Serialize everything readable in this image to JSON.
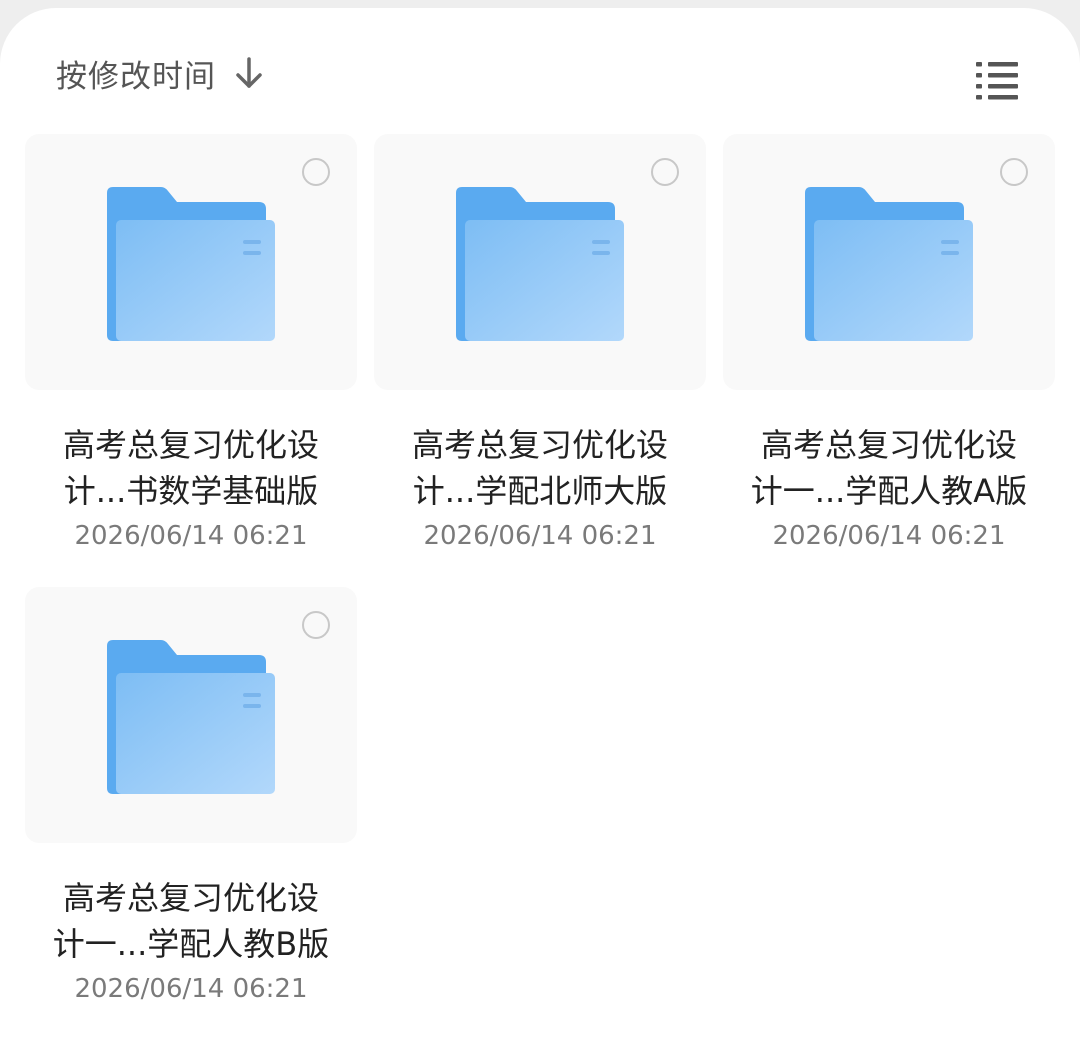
{
  "toolbar": {
    "sort_label": "按修改时间",
    "sort_icon": "arrow-down-icon",
    "view_icon": "list-view-icon"
  },
  "colors": {
    "folder_back": "#5aaaf0",
    "folder_front_start": "#7dbdf4",
    "folder_front_end": "#b2d8fb",
    "card_bg": "#f9f9f9"
  },
  "folders": [
    {
      "name": "高考总复习优化设\n计...书数学基础版",
      "date": "2026/06/14 06:21",
      "icon": "folder-icon"
    },
    {
      "name": "高考总复习优化设\n计...学配北师大版",
      "date": "2026/06/14 06:21",
      "icon": "folder-icon"
    },
    {
      "name": "高考总复习优化设\n计一...学配人教A版",
      "date": "2026/06/14 06:21",
      "icon": "folder-icon"
    },
    {
      "name": "高考总复习优化设\n计一...学配人教B版",
      "date": "2026/06/14 06:21",
      "icon": "folder-icon"
    }
  ]
}
